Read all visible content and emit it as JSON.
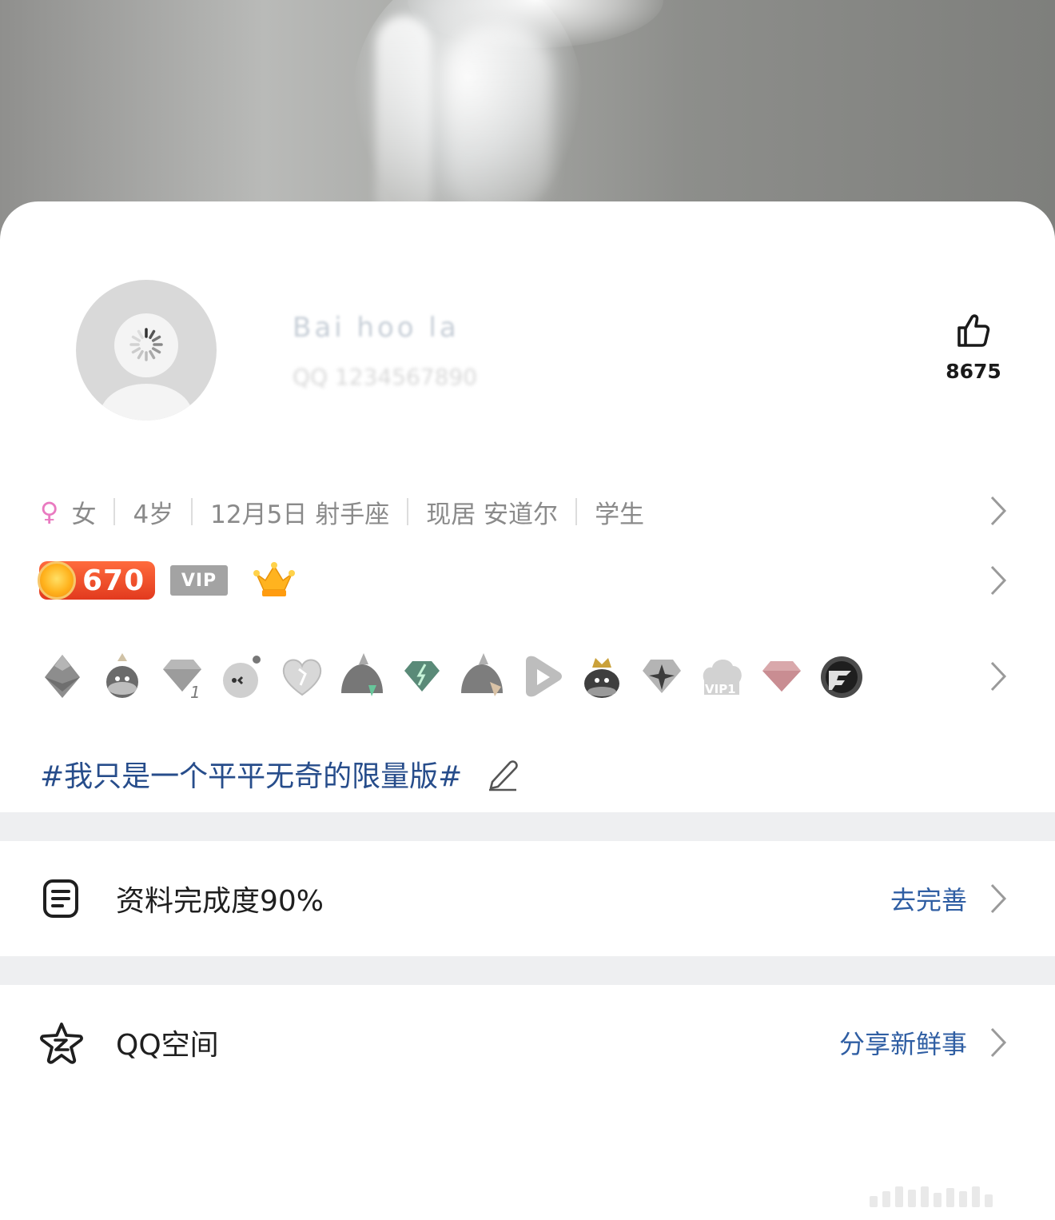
{
  "profile": {
    "nickname": "Bai hoo la",
    "qq_label": "QQ 1234567890",
    "like_count": "8675"
  },
  "info": {
    "gender": "女",
    "age": "4岁",
    "birthday": "12月5日 射手座",
    "location": "现居 安道尔",
    "occupation": "学生"
  },
  "badges": {
    "level": "670",
    "vip": "VIP"
  },
  "medals": [
    "shield-medal-icon",
    "penguin-medal-icon",
    "diamond-1-medal-icon",
    "bomb-face-medal-icon",
    "heart-medal-icon",
    "mountain-medal-icon",
    "green-diamond-medal-icon",
    "mountain2-medal-icon",
    "play-medal-icon",
    "king-penguin-medal-icon",
    "star-diamond-medal-icon",
    "cloud-vip1-medal-icon",
    "pink-diamond-medal-icon",
    "cf-medal-icon"
  ],
  "signature": "#我只是一个平平无奇的限量版#",
  "completion": {
    "label": "资料完成度90%",
    "action": "去完善"
  },
  "qzone": {
    "label": "QQ空间",
    "action": "分享新鲜事"
  },
  "colors": {
    "accent": "#2f5ea3",
    "tag": "#274d8b",
    "female": "#e97ac0",
    "level": "#e23a1e"
  }
}
